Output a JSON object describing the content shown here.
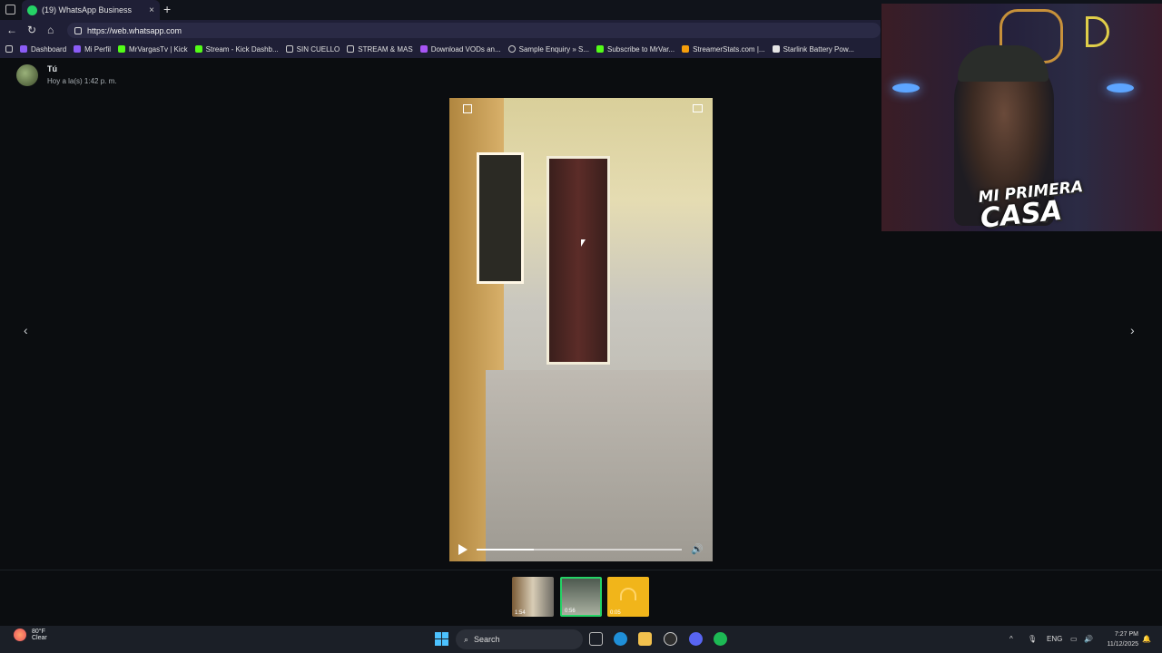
{
  "browser": {
    "tab_title": "(19) WhatsApp Business",
    "tab_close": "×",
    "new_tab": "+",
    "url": "https://web.whatsapp.com",
    "bookmarks": [
      {
        "label": "Dashboard",
        "color": "#8b5cf6"
      },
      {
        "label": "Mi Perfil",
        "color": "#8b5cf6"
      },
      {
        "label": "MrVargasTv | Kick",
        "color": "#53fc18"
      },
      {
        "label": "Stream - Kick Dashb...",
        "color": "#53fc18"
      },
      {
        "label": "SIN CUELLO",
        "color": "#cccccc"
      },
      {
        "label": "STREAM & MAS",
        "color": "#cccccc"
      },
      {
        "label": "Download VODs an...",
        "color": "#a855f7"
      },
      {
        "label": "Sample Enquiry » S...",
        "color": "#cccccc"
      },
      {
        "label": "Subscribe to MrVar...",
        "color": "#53fc18"
      },
      {
        "label": "StreamerStats.com |...",
        "color": "#f59e0b"
      },
      {
        "label": "Starlink Battery Pow...",
        "color": "#e5e5e5"
      }
    ]
  },
  "chat": {
    "sender": "Tú",
    "sent_time": "Hoy a la(s) 1:42 p. m."
  },
  "viewer": {
    "prev": "‹",
    "next": "›",
    "progress": 0.28,
    "volume_icon": "speaker-icon"
  },
  "thumbnails": [
    {
      "duration": "1:54",
      "selected": false
    },
    {
      "duration": "0:56",
      "selected": true
    },
    {
      "duration": "0:05",
      "selected": false
    }
  ],
  "overlay": {
    "line1": "MI PRIMERA",
    "line2": "CASA"
  },
  "taskbar": {
    "temperature": "80°F",
    "weather": "Clear",
    "search_label": "Search",
    "language": "ENG",
    "time": "7:27 PM",
    "date": "11/12/2025"
  }
}
